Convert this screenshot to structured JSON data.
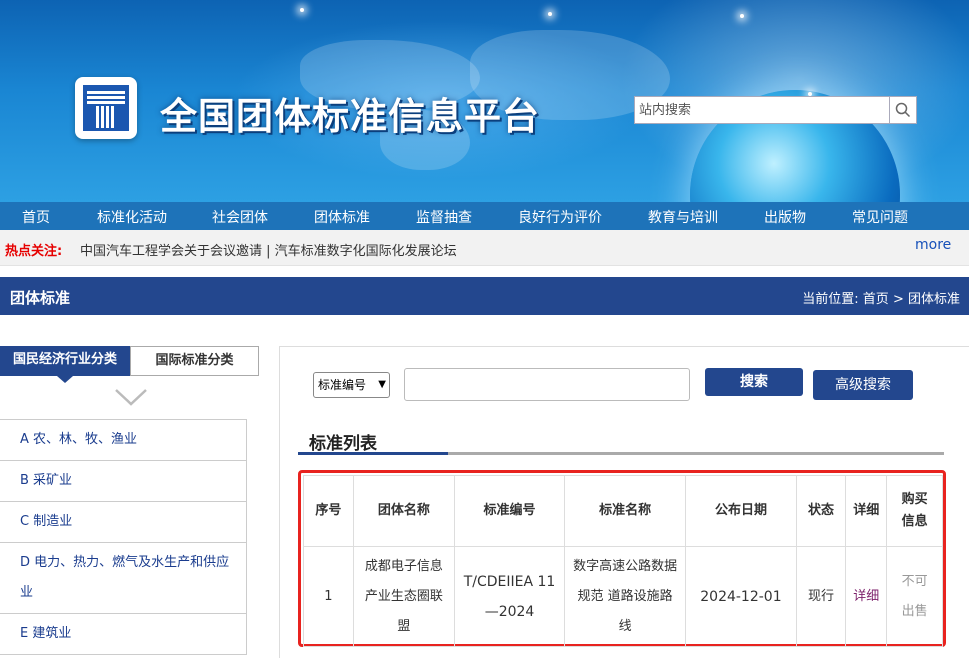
{
  "site": {
    "title": "全国团体标准信息平台",
    "search_placeholder": "站内搜索"
  },
  "nav": [
    "首页",
    "标准化活动",
    "社会团体",
    "团体标准",
    "监督抽查",
    "良好行为评价",
    "教育与培训",
    "出版物",
    "常见问题"
  ],
  "hot": {
    "label": "热点关注:",
    "text": "中国汽车工程学会关于会议邀请 | 汽车标准数字化国际化发展论坛",
    "more": "more"
  },
  "titlebar": {
    "title": "团体标准",
    "crumb_prefix": "当前位置:",
    "crumb_home": "首页",
    "crumb_sep": ">",
    "crumb_current": "团体标准"
  },
  "sidebar": {
    "tab_active": "国民经济行业分类",
    "tab_inactive": "国际标准分类",
    "items": [
      "A 农、林、牧、渔业",
      "B 采矿业",
      "C 制造业",
      "D 电力、热力、燃气及水生产和供应业",
      "E 建筑业"
    ]
  },
  "search": {
    "select_value": "标准编号",
    "search_button": "搜索",
    "advanced_button": "高级搜索"
  },
  "list": {
    "title": "标准列表",
    "headers": [
      "序号",
      "团体名称",
      "标准编号",
      "标准名称",
      "公布日期",
      "状态",
      "详细",
      "购买信息"
    ],
    "rows": [
      {
        "index": "1",
        "org": "成都电子信息产业生态圈联盟",
        "code": "T/CDEIIEA 11—2024",
        "name": "数字高速公路数据规范 道路设施路线",
        "date": "2024-12-01",
        "status": "现行",
        "detail": "详细",
        "purchase": "不可出售"
      }
    ]
  },
  "colors": {
    "brand_dark": "#23478e",
    "nav_blue": "#1e73b9",
    "hot_red": "#e60000",
    "highlight_red": "#e8231f"
  }
}
